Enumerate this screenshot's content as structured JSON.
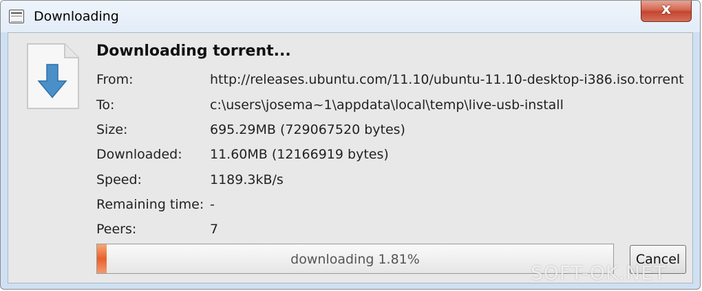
{
  "window": {
    "title": "Downloading",
    "close_label": "x"
  },
  "content": {
    "heading": "Downloading torrent...",
    "fields": [
      {
        "label": "From:",
        "value": "http://releases.ubuntu.com/11.10/ubuntu-11.10-desktop-i386.iso.torrent"
      },
      {
        "label": "To:",
        "value": "c:\\users\\josema~1\\appdata\\local\\temp\\live-usb-install"
      },
      {
        "label": "Size:",
        "value": "695.29MB (729067520 bytes)"
      },
      {
        "label": "Downloaded:",
        "value": "11.60MB (12166919 bytes)"
      },
      {
        "label": "Speed:",
        "value": "1189.3kB/s"
      },
      {
        "label": "Remaining time:",
        "value": "-"
      },
      {
        "label": "Peers:",
        "value": "7"
      }
    ],
    "progress": {
      "text": "downloading 1.81%",
      "fraction": 0.0181
    },
    "cancel_label": "Cancel"
  },
  "icons": {
    "app": "window-icon",
    "document": "download-document-icon",
    "close": "close-icon"
  },
  "colors": {
    "progress_fill": "#e8612b",
    "close_button": "#c44530",
    "arrow": "#4a8fc8"
  },
  "watermark": "SOFT-OK.NET"
}
